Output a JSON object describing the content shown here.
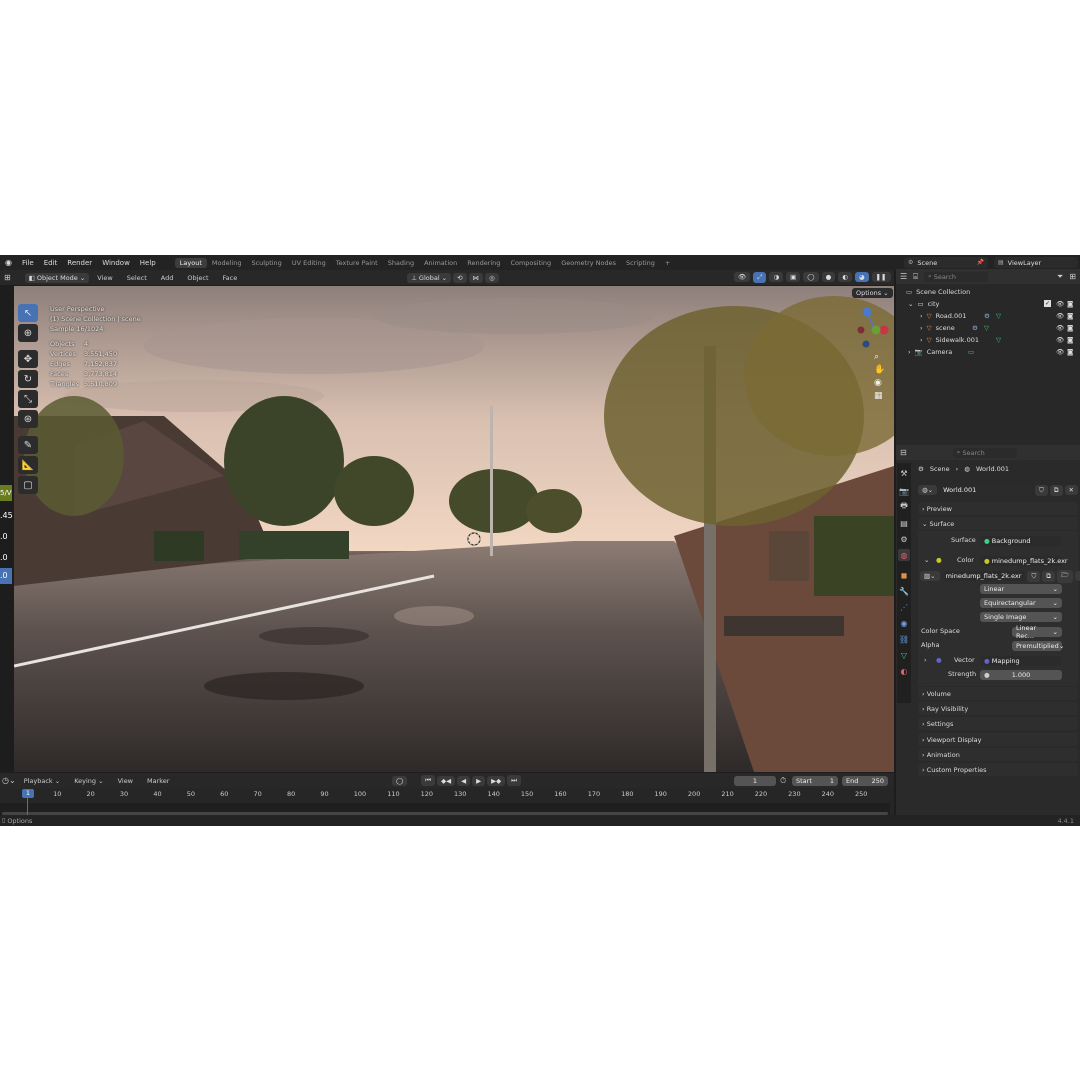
{
  "menu": [
    "File",
    "Edit",
    "Render",
    "Window",
    "Help"
  ],
  "workspaces": [
    {
      "label": "Layout",
      "active": true
    },
    {
      "label": "Modeling"
    },
    {
      "label": "Sculpting"
    },
    {
      "label": "UV Editing"
    },
    {
      "label": "Texture Paint"
    },
    {
      "label": "Shading"
    },
    {
      "label": "Animation"
    },
    {
      "label": "Rendering"
    },
    {
      "label": "Compositing"
    },
    {
      "label": "Geometry Nodes"
    },
    {
      "label": "Scripting"
    },
    {
      "label": "+"
    }
  ],
  "scene_name": "Scene",
  "view_layer": "ViewLayer",
  "viewport_header": {
    "mode": "Object Mode",
    "menus": [
      "View",
      "Select",
      "Add",
      "Object",
      "Face"
    ],
    "orientation": "Global",
    "options": "Options"
  },
  "overlay": {
    "lines": [
      "User Perspective",
      "(1) Scene Collection | scene",
      "Sample 16/1024"
    ],
    "stats": [
      {
        "label": "Objects",
        "value": "4"
      },
      {
        "label": "Vertices",
        "value": "3,551,450"
      },
      {
        "label": "Edges",
        "value": "7,152,837"
      },
      {
        "label": "Faces",
        "value": "3,773,814"
      },
      {
        "label": "Triangles",
        "value": "5,510,809"
      }
    ]
  },
  "left_edge_fragments": [
    "5/V",
    ".45",
    ".0",
    ".0",
    ".0"
  ],
  "outliner": {
    "search_placeholder": "Search",
    "root": "Scene Collection",
    "items": [
      {
        "label": "city",
        "depth": 1
      },
      {
        "label": "Road.001",
        "depth": 2
      },
      {
        "label": "scene",
        "depth": 2
      },
      {
        "label": "Sidewalk.001",
        "depth": 2
      },
      {
        "label": "Camera",
        "depth": 1
      }
    ]
  },
  "properties": {
    "search_placeholder": "Search",
    "breadcrumb": [
      "Scene",
      "World.001"
    ],
    "world_name": "World.001",
    "sections": {
      "preview": "Preview",
      "surface": "Surface"
    },
    "surface_label": "Surface",
    "surface_value": "Background",
    "color_label": "Color",
    "color_value": "minedump_flats_2k.exr",
    "image_name": "minedump_flats_2k.exr",
    "interpolation": "Linear",
    "projection": "Equirectangular",
    "source": "Single Image",
    "color_space_label": "Color Space",
    "color_space_value": "Linear Rec...",
    "alpha_label": "Alpha",
    "alpha_value": "Premultiplied",
    "vector_label": "Vector",
    "vector_value": "Mapping",
    "strength_label": "Strength",
    "strength_value": "1.000",
    "panels": [
      "Volume",
      "Ray Visibility",
      "Settings",
      "Viewport Display",
      "Animation",
      "Custom Properties"
    ]
  },
  "timeline": {
    "menus": [
      "Playback",
      "Keying",
      "View",
      "Marker"
    ],
    "current_frame": "1",
    "start_label": "Start",
    "start_value": "1",
    "end_label": "End",
    "end_value": "250",
    "ticks": [
      "1",
      "10",
      "20",
      "30",
      "40",
      "50",
      "60",
      "70",
      "80",
      "90",
      "100",
      "110",
      "120",
      "130",
      "140",
      "150",
      "160",
      "170",
      "180",
      "190",
      "200",
      "210",
      "220",
      "230",
      "240",
      "250"
    ]
  },
  "status_bar": {
    "left": "Options",
    "version": "4.4.1"
  },
  "colors": {
    "accent": "#4772b3",
    "panel": "#303030",
    "background": "#1d1d1d"
  }
}
